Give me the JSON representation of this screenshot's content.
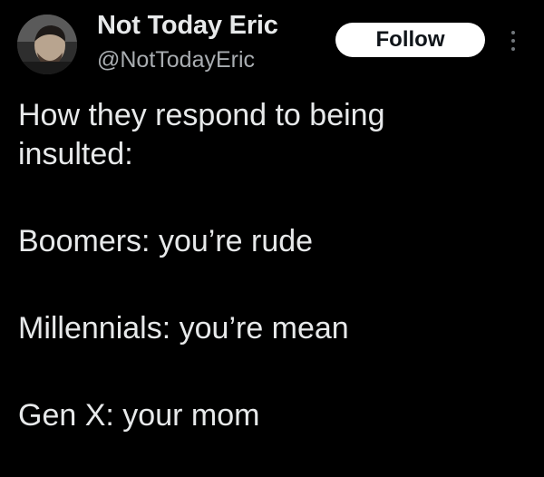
{
  "post": {
    "author": {
      "display_name": "Not Today Eric",
      "handle": "@NotTodayEric",
      "avatar_icon": "user-avatar"
    },
    "follow_label": "Follow",
    "more_icon": "more-vertical-icon",
    "text_lines": [
      "How they respond to being",
      "insulted:",
      "Boomers: you’re rude",
      "Millennials: you’re mean",
      "Gen X: your mom"
    ]
  },
  "colors": {
    "background": "#000000",
    "primary_text": "#e7e9ea",
    "secondary_text": "#a9adb1",
    "button_bg": "#ffffff",
    "button_text": "#0f1419"
  }
}
